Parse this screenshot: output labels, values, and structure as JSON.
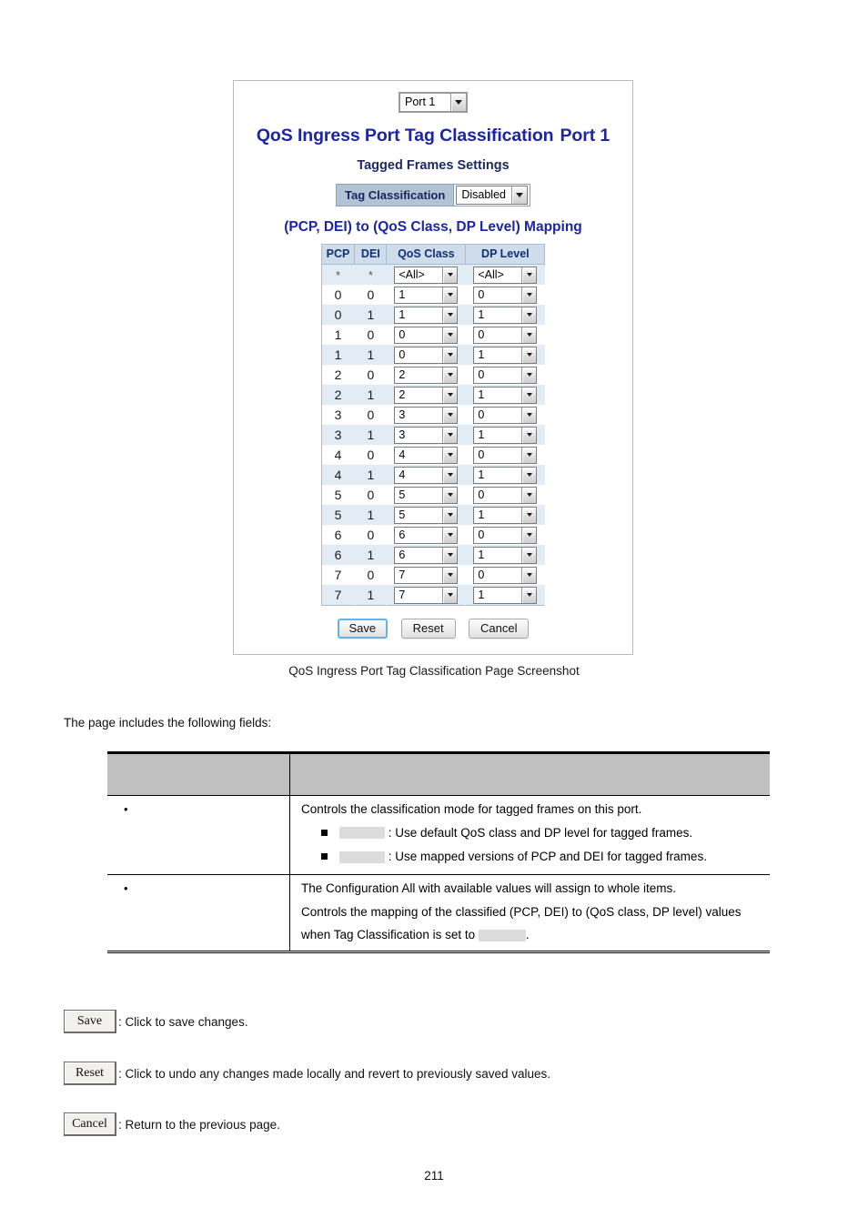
{
  "screenshot_panel": {
    "port_selector": {
      "value": "Port 1"
    },
    "title": "QoS Ingress Port Tag Classification",
    "title_port": "Port 1",
    "subtitle": "Tagged Frames Settings",
    "tag_classification": {
      "label": "Tag Classification",
      "value": "Disabled"
    },
    "mapping_title": "(PCP, DEI) to (QoS Class, DP Level) Mapping",
    "mapping_table": {
      "columns": [
        "PCP",
        "DEI",
        "QoS Class",
        "DP Level"
      ],
      "rows": [
        {
          "pcp": "*",
          "dei": "*",
          "qos_class": "<All>",
          "dp_level": "<All>"
        },
        {
          "pcp": "0",
          "dei": "0",
          "qos_class": "1",
          "dp_level": "0"
        },
        {
          "pcp": "0",
          "dei": "1",
          "qos_class": "1",
          "dp_level": "1"
        },
        {
          "pcp": "1",
          "dei": "0",
          "qos_class": "0",
          "dp_level": "0"
        },
        {
          "pcp": "1",
          "dei": "1",
          "qos_class": "0",
          "dp_level": "1"
        },
        {
          "pcp": "2",
          "dei": "0",
          "qos_class": "2",
          "dp_level": "0"
        },
        {
          "pcp": "2",
          "dei": "1",
          "qos_class": "2",
          "dp_level": "1"
        },
        {
          "pcp": "3",
          "dei": "0",
          "qos_class": "3",
          "dp_level": "0"
        },
        {
          "pcp": "3",
          "dei": "1",
          "qos_class": "3",
          "dp_level": "1"
        },
        {
          "pcp": "4",
          "dei": "0",
          "qos_class": "4",
          "dp_level": "0"
        },
        {
          "pcp": "4",
          "dei": "1",
          "qos_class": "4",
          "dp_level": "1"
        },
        {
          "pcp": "5",
          "dei": "0",
          "qos_class": "5",
          "dp_level": "0"
        },
        {
          "pcp": "5",
          "dei": "1",
          "qos_class": "5",
          "dp_level": "1"
        },
        {
          "pcp": "6",
          "dei": "0",
          "qos_class": "6",
          "dp_level": "0"
        },
        {
          "pcp": "6",
          "dei": "1",
          "qos_class": "6",
          "dp_level": "1"
        },
        {
          "pcp": "7",
          "dei": "0",
          "qos_class": "7",
          "dp_level": "0"
        },
        {
          "pcp": "7",
          "dei": "1",
          "qos_class": "7",
          "dp_level": "1"
        }
      ]
    },
    "buttons": {
      "save": "Save",
      "reset": "Reset",
      "cancel": "Cancel"
    }
  },
  "caption": "QoS Ingress Port Tag Classification Page Screenshot",
  "intro": "The page includes the following fields:",
  "field_table": {
    "header": {
      "col1": "",
      "col2": ""
    },
    "rows": [
      {
        "name": "",
        "bullet": "•",
        "desc_lines": [
          "Controls the classification mode for tagged frames on this port."
        ],
        "sub_items": [
          {
            "term": "",
            "text": ": Use default QoS class and DP level for tagged frames."
          },
          {
            "term": "",
            "text": ": Use mapped versions of PCP and DEI for tagged frames."
          }
        ]
      },
      {
        "name": "",
        "bullet": "•",
        "desc_lines": [
          "The Configuration All with available values will assign to whole items.",
          "Controls the mapping of the classified (PCP, DEI) to (QoS class, DP level) values",
          "when Tag Classification is set to"
        ],
        "trailing_redacted": true,
        "trailing_period": "."
      }
    ]
  },
  "button_help": [
    {
      "button": "Save",
      "desc": ": Click to save changes."
    },
    {
      "button": "Reset",
      "desc": ": Click to undo any changes made locally and revert to previously saved values."
    },
    {
      "button": "Cancel",
      "desc": ": Return to the previous page."
    }
  ],
  "page_number": "211",
  "colors": {
    "title_blue": "#1c25a6",
    "table_header_blue": "#cfdcea",
    "row_alt_blue": "#e3ecf5",
    "tag_label_blue": "#b2c3d6",
    "field_header_gray": "#c0c0c0",
    "redact_gray": "#dcdcdc"
  }
}
